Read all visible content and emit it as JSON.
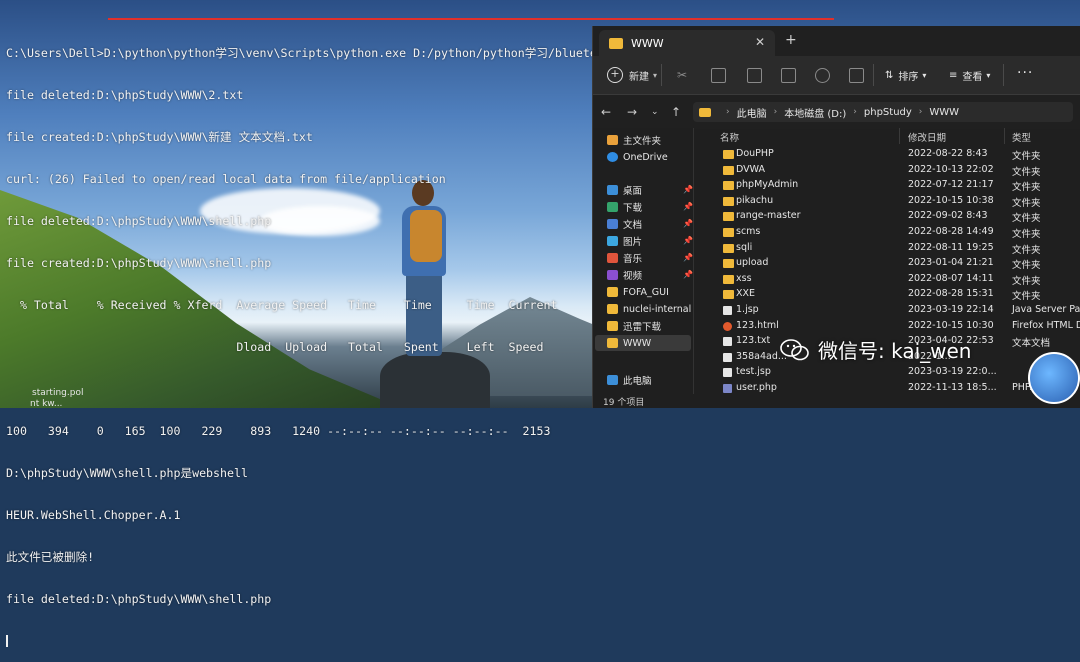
{
  "terminal": {
    "lines": [
      "C:\\Users\\Dell>D:\\python\\python学习\\venv\\Scripts\\python.exe D:/python/python学习/bluetearm/filelisten.py D:\\phpStudy\\WWW",
      "file deleted:D:\\phpStudy\\WWW\\2.txt",
      "file created:D:\\phpStudy\\WWW\\新建 文本文档.txt",
      "curl: (26) Failed to open/read local data from file/application",
      "file deleted:D:\\phpStudy\\WWW\\shell.php",
      "file created:D:\\phpStudy\\WWW\\shell.php",
      "  % Total    % Received % Xferd  Average Speed   Time    Time     Time  Current",
      "                                 Dload  Upload   Total   Spent    Left  Speed",
      "",
      "100   394    0   165  100   229    893   1240 --:--:-- --:--:-- --:--:--  2153",
      "D:\\phpStudy\\WWW\\shell.php是webshell",
      "HEUR.WebShell.Chopper.A.1",
      "此文件已被删除!",
      "file deleted:D:\\phpStudy\\WWW\\shell.php"
    ]
  },
  "desktop": {
    "taskbar_text_1": "starting.pol",
    "taskbar_text_2": "nt kw..."
  },
  "explorer": {
    "tab_label": "WWW",
    "new_tab": "+",
    "toolbar": {
      "new_label": "新建",
      "sort_label": "排序",
      "view_label": "查看",
      "more": "···"
    },
    "address": {
      "crumbs": [
        "此电脑",
        "本地磁盘 (D:)",
        "phpStudy",
        "WWW"
      ]
    },
    "sidebar": [
      {
        "label": "主文件夹",
        "icon": "home-icon"
      },
      {
        "label": "OneDrive",
        "icon": "cloud-icon"
      },
      {
        "label": "桌面",
        "icon": "desktop-icon",
        "pinned": true
      },
      {
        "label": "下载",
        "icon": "download-icon",
        "pinned": true
      },
      {
        "label": "文档",
        "icon": "document-icon",
        "pinned": true
      },
      {
        "label": "图片",
        "icon": "picture-icon",
        "pinned": true
      },
      {
        "label": "音乐",
        "icon": "music-icon",
        "pinned": true
      },
      {
        "label": "视频",
        "icon": "video-icon",
        "pinned": true
      },
      {
        "label": "FOFA_GUI",
        "icon": "folder-icon"
      },
      {
        "label": "nuclei-internal",
        "icon": "folder-icon"
      },
      {
        "label": "迅雷下载",
        "icon": "folder-icon"
      },
      {
        "label": "WWW",
        "icon": "folder-icon",
        "selected": true
      },
      {
        "label": "此电脑",
        "icon": "computer-icon"
      }
    ],
    "columns": {
      "name": "名称",
      "date": "修改日期",
      "type": "类型"
    },
    "files": [
      {
        "name": "DouPHP",
        "date": "2022-08-22 8:43",
        "type": "文件夹",
        "kind": "folder"
      },
      {
        "name": "DVWA",
        "date": "2022-10-13 22:02",
        "type": "文件夹",
        "kind": "folder"
      },
      {
        "name": "phpMyAdmin",
        "date": "2022-07-12 21:17",
        "type": "文件夹",
        "kind": "folder"
      },
      {
        "name": "pikachu",
        "date": "2022-10-15 10:38",
        "type": "文件夹",
        "kind": "folder"
      },
      {
        "name": "range-master",
        "date": "2022-09-02 8:43",
        "type": "文件夹",
        "kind": "folder"
      },
      {
        "name": "scms",
        "date": "2022-08-28 14:49",
        "type": "文件夹",
        "kind": "folder"
      },
      {
        "name": "sqli",
        "date": "2022-08-11 19:25",
        "type": "文件夹",
        "kind": "folder"
      },
      {
        "name": "upload",
        "date": "2023-01-04 21:21",
        "type": "文件夹",
        "kind": "folder"
      },
      {
        "name": "xss",
        "date": "2022-08-07 14:11",
        "type": "文件夹",
        "kind": "folder"
      },
      {
        "name": "XXE",
        "date": "2022-08-28 15:31",
        "type": "文件夹",
        "kind": "folder"
      },
      {
        "name": "1.jsp",
        "date": "2023-03-19 22:14",
        "type": "Java Server Page",
        "kind": "file"
      },
      {
        "name": "123.html",
        "date": "2022-10-15 10:30",
        "type": "Firefox HTML D...",
        "kind": "html"
      },
      {
        "name": "123.txt",
        "date": "2023-04-02 22:53",
        "type": "文本文档",
        "kind": "file"
      },
      {
        "name": "358a4ad...",
        "date": "2022-1...",
        "type": "",
        "kind": "file"
      },
      {
        "name": "test.jsp",
        "date": "2023-03-19 22:0...",
        "type": "",
        "kind": "file"
      },
      {
        "name": "user.php",
        "date": "2022-11-13 18:5...",
        "type": "PHP...",
        "kind": "php"
      }
    ],
    "status": "19 个项目"
  },
  "watermark": {
    "text": "微信号: kai_wen"
  },
  "colors": {
    "folder": "#f0b93a",
    "underline": "#e0302b"
  }
}
